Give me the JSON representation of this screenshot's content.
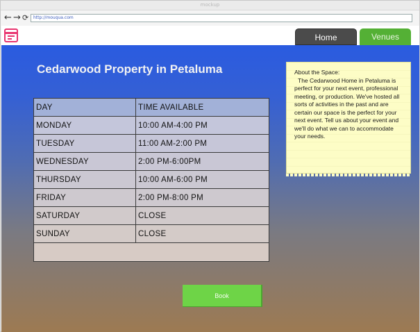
{
  "browser": {
    "title": "mockup",
    "url": "http://mouqua.com"
  },
  "nav": {
    "tabs": [
      {
        "label": "Home"
      },
      {
        "label": "Venues"
      }
    ]
  },
  "page": {
    "title": "Cedarwood Property in Petaluma"
  },
  "schedule": {
    "headers": [
      "DAY",
      "TIME AVAILABLE"
    ],
    "rows": [
      {
        "day": "MONDAY",
        "time": "10:00 AM-4:00 PM"
      },
      {
        "day": "TUESDAY",
        "time": "11:00 AM-2:00 PM"
      },
      {
        "day": "WEDNESDAY",
        "time": "2:00 PM-6:00PM"
      },
      {
        "day": "THURSDAY",
        "time": "10:00 AM-6:00 PM"
      },
      {
        "day": "FRIDAY",
        "time": "2:00 PM-8:00 PM"
      },
      {
        "day": "SATURDAY",
        "time": "CLOSE"
      },
      {
        "day": "SUNDAY",
        "time": "CLOSE"
      }
    ]
  },
  "about": {
    "heading": "About the Space:",
    "body": "The Cedarwood Home in Petaluma is perfect for your next event, professional meeting, or production. We've hosted all sorts of activities in the past and are certain our space is the perfect for your next event. Tell us about your event and we'll do what we can to accommodate your needs."
  },
  "actions": {
    "book_label": "Book"
  },
  "colors": {
    "accent_green": "#6ed447",
    "tab_dark": "#4b4b4b",
    "gradient_top": "#2a5be0",
    "gradient_bottom": "#9d7a52",
    "logo_pink": "#e8346f"
  },
  "icons": [
    "back-arrow-icon",
    "forward-arrow-icon",
    "refresh-icon",
    "calendar-logo-icon"
  ]
}
